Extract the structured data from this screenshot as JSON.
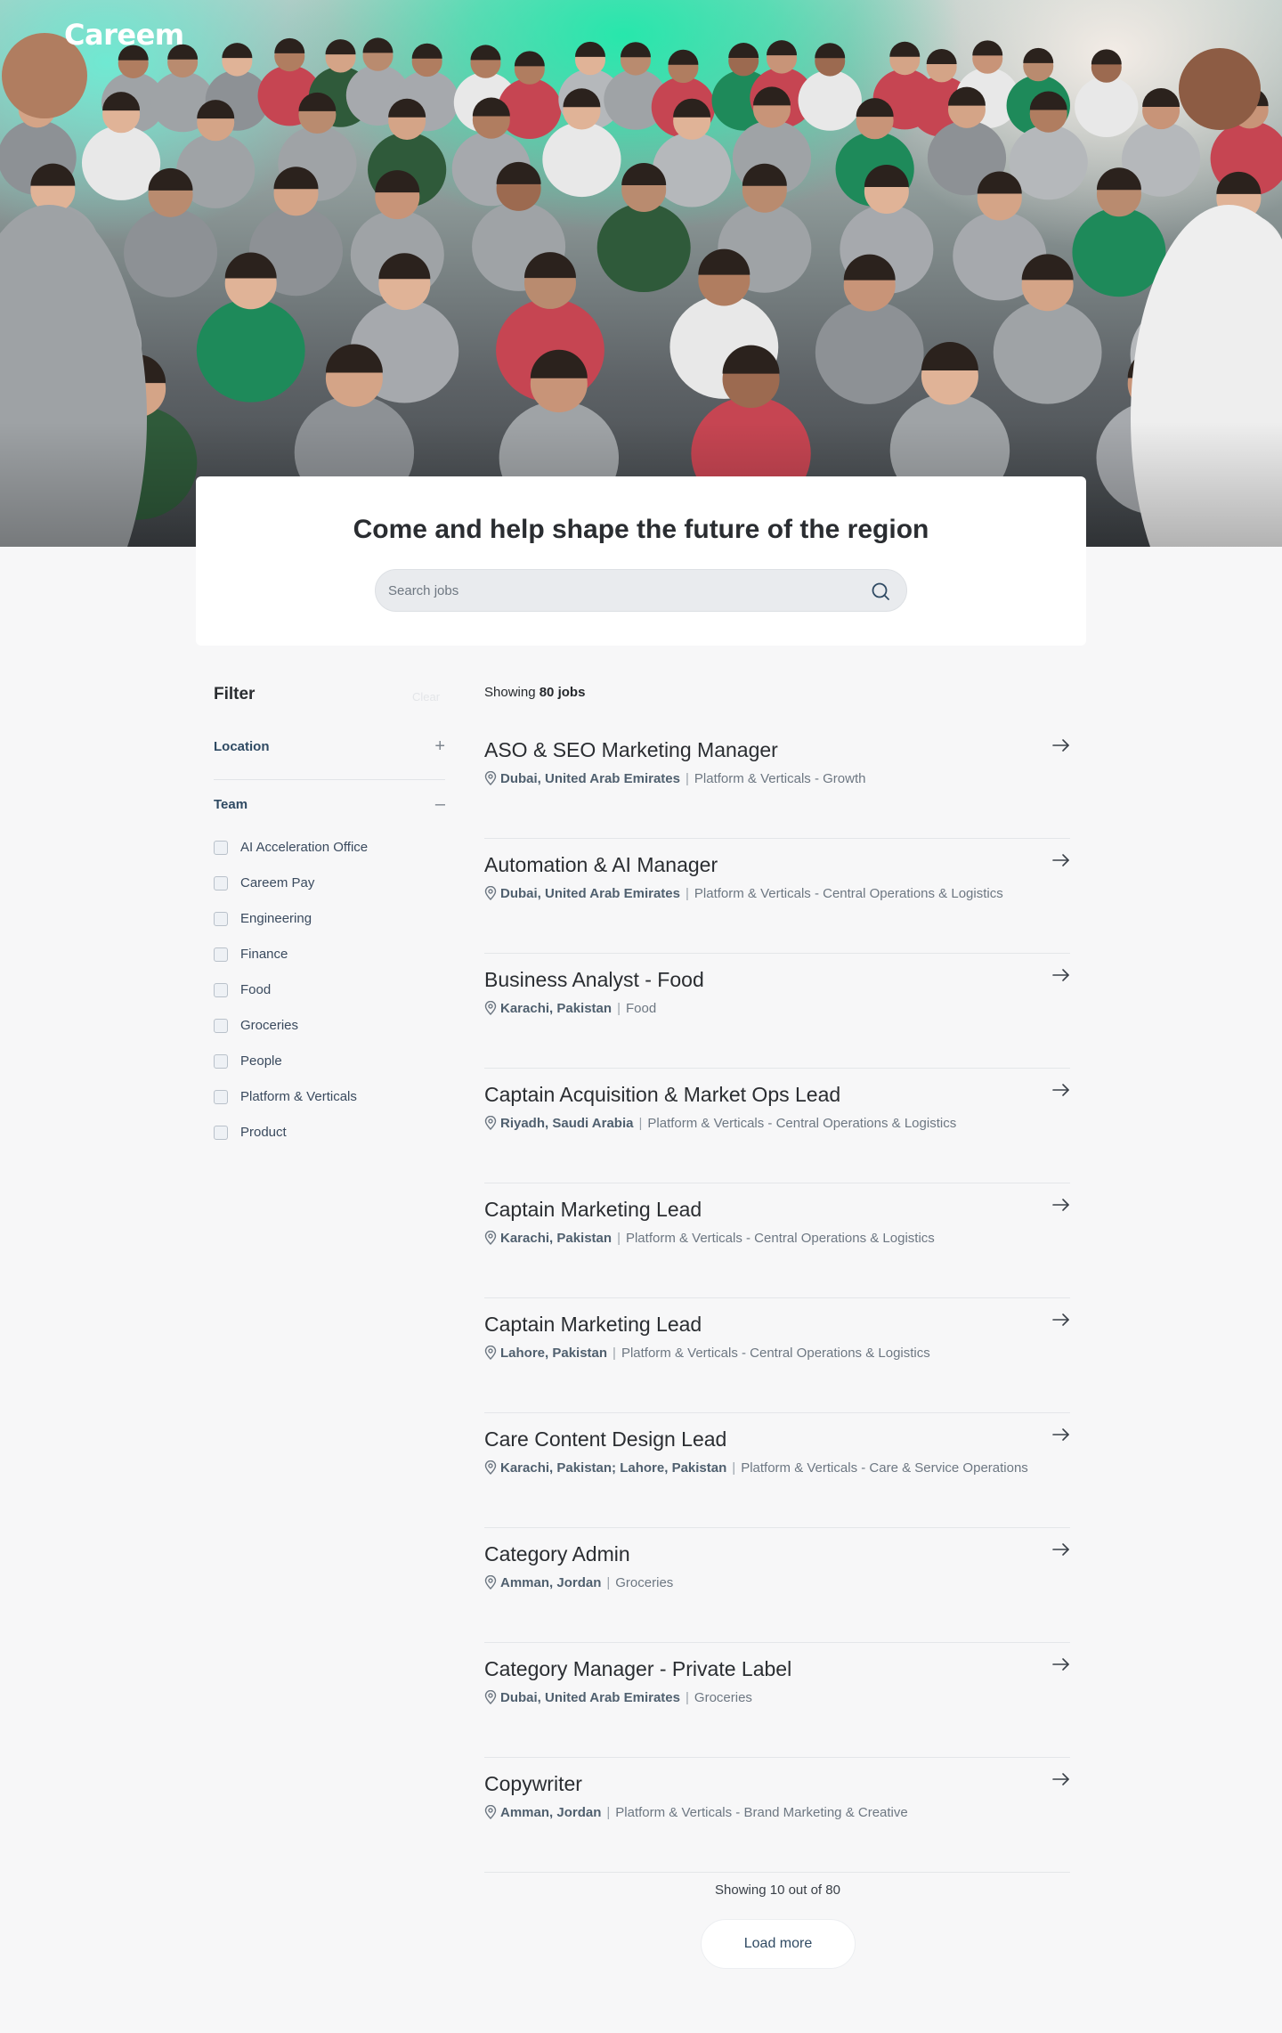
{
  "brand": {
    "logo_text": "Careem"
  },
  "hero": {
    "headline": "Come and help shape the future of the region"
  },
  "search": {
    "placeholder": "Search jobs",
    "value": ""
  },
  "filter": {
    "title": "Filter",
    "clear_label": "Clear",
    "groups": [
      {
        "label": "Location",
        "state": "collapsed",
        "toggle": "+"
      },
      {
        "label": "Team",
        "state": "expanded",
        "toggle": "–"
      }
    ],
    "team_options": [
      {
        "label": "AI Acceleration Office",
        "checked": false
      },
      {
        "label": "Careem Pay",
        "checked": false
      },
      {
        "label": "Engineering",
        "checked": false
      },
      {
        "label": "Finance",
        "checked": false
      },
      {
        "label": "Food",
        "checked": false
      },
      {
        "label": "Groceries",
        "checked": false
      },
      {
        "label": "People",
        "checked": false
      },
      {
        "label": "Platform & Verticals",
        "checked": false
      },
      {
        "label": "Product",
        "checked": false
      }
    ]
  },
  "results": {
    "showing_prefix": "Showing",
    "total": "80 jobs",
    "jobs": [
      {
        "title": "ASO & SEO Marketing Manager",
        "location": "Dubai, United Arab Emirates",
        "team": "Platform & Verticals - Growth"
      },
      {
        "title": "Automation & AI Manager",
        "location": "Dubai, United Arab Emirates",
        "team": "Platform & Verticals - Central Operations & Logistics"
      },
      {
        "title": "Business Analyst - Food",
        "location": "Karachi, Pakistan",
        "team": "Food"
      },
      {
        "title": "Captain Acquisition & Market Ops Lead",
        "location": "Riyadh, Saudi Arabia",
        "team": "Platform & Verticals - Central Operations & Logistics"
      },
      {
        "title": "Captain Marketing Lead",
        "location": "Karachi, Pakistan",
        "team": "Platform & Verticals - Central Operations & Logistics"
      },
      {
        "title": "Captain Marketing Lead",
        "location": "Lahore, Pakistan",
        "team": "Platform & Verticals - Central Operations & Logistics"
      },
      {
        "title": "Care Content Design Lead",
        "location": "Karachi, Pakistan; Lahore, Pakistan",
        "team": "Platform & Verticals - Care & Service Operations"
      },
      {
        "title": "Category Admin",
        "location": "Amman, Jordan",
        "team": "Groceries"
      },
      {
        "title": "Category Manager - Private Label",
        "location": "Dubai, United Arab Emirates",
        "team": "Groceries"
      },
      {
        "title": "Copywriter",
        "location": "Amman, Jordan",
        "team": "Platform & Verticals - Brand Marketing & Creative"
      }
    ],
    "pagination_text": "Showing 10 out of 80",
    "load_more_label": "Load more"
  },
  "icons": {
    "search": "search-icon",
    "arrow": "arrow-right-icon",
    "pin": "location-pin-icon",
    "plus": "plus-icon",
    "minus": "minus-icon"
  },
  "colors": {
    "accent_green": "#27e7ac",
    "text_dark": "#2a2d31",
    "text_navy": "#2f4a63",
    "background": "#f7f7f8"
  }
}
